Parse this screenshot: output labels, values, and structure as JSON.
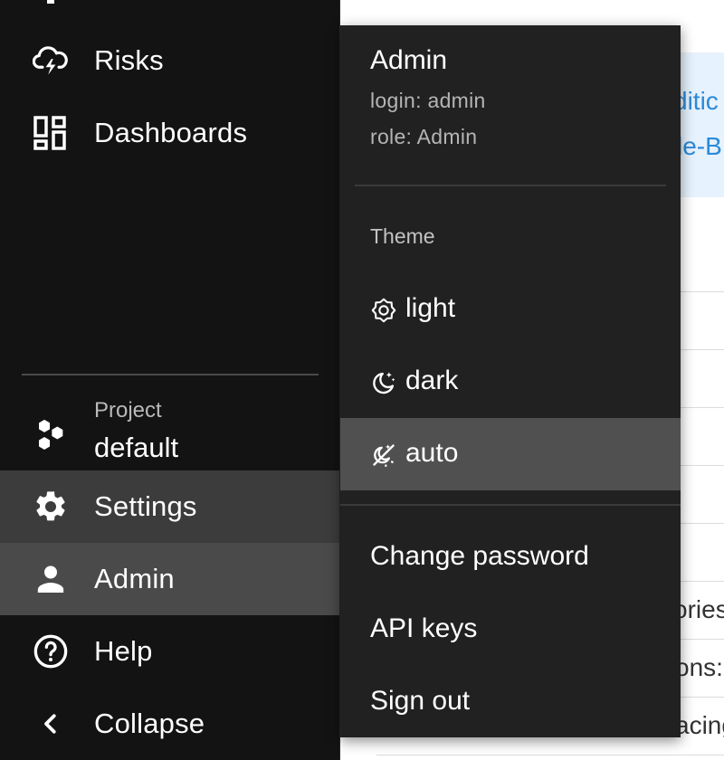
{
  "sidebar": {
    "items": [
      {
        "label": "Risks",
        "icon": "cloud-lightning-icon"
      },
      {
        "label": "Dashboards",
        "icon": "dashboard-icon"
      }
    ],
    "project": {
      "caption": "Project",
      "value": "default",
      "icon": "hexagons-icon"
    },
    "bottom_items": [
      {
        "label": "Settings",
        "icon": "gear-icon"
      },
      {
        "label": "Admin",
        "icon": "person-icon"
      },
      {
        "label": "Help",
        "icon": "help-circle-icon"
      },
      {
        "label": "Collapse",
        "icon": "chevron-left-icon"
      }
    ]
  },
  "background": {
    "banner_line1": "ditic",
    "banner_line2": "le-B",
    "row_text1": "ories",
    "row_text2": "ons:e",
    "row_text3": "acing"
  },
  "user_menu": {
    "name": "Admin",
    "login": "login: admin",
    "role": "role: Admin",
    "theme_label": "Theme",
    "theme_options": [
      {
        "label": "light",
        "icon": "brightness-icon",
        "selected": false
      },
      {
        "label": "dark",
        "icon": "moon-stars-icon",
        "selected": false
      },
      {
        "label": "auto",
        "icon": "auto-theme-icon",
        "selected": true
      }
    ],
    "actions": [
      "Change password",
      "API keys",
      "Sign out"
    ]
  },
  "colors": {
    "sidebar_bg": "#131313",
    "menu_bg": "#212121",
    "selected_bg": "#505050",
    "link": "#2b8ad9",
    "banner_bg": "#e6f2fd"
  }
}
